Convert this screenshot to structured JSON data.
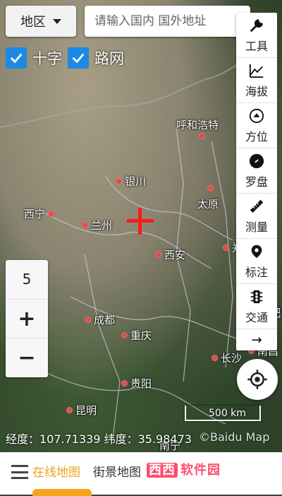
{
  "header": {
    "region_label": "地区",
    "search_placeholder": "请输入国内 国外地址",
    "close_symbol": "✕"
  },
  "layers": {
    "crosshair_label": "十字",
    "roadnet_label": "路网",
    "crosshair_checked": true,
    "roadnet_checked": true
  },
  "toolbar": {
    "items": [
      {
        "label": "工具",
        "icon": "wrench-icon"
      },
      {
        "label": "海拔",
        "icon": "elevation-chart-icon"
      },
      {
        "label": "方位",
        "icon": "direction-icon"
      },
      {
        "label": "罗盘",
        "icon": "compass-icon"
      },
      {
        "label": "测量",
        "icon": "ruler-icon"
      },
      {
        "label": "标注",
        "icon": "map-pin-icon"
      },
      {
        "label": "交通",
        "icon": "traffic-light-icon"
      }
    ],
    "more_symbol": "→"
  },
  "zoom": {
    "level": "5",
    "plus": "+",
    "minus": "−"
  },
  "map": {
    "cities": [
      {
        "name": "呼和浩特",
        "id": "hohhot"
      },
      {
        "name": "银川",
        "id": "yinchuan"
      },
      {
        "name": "太原",
        "id": "taiyuan"
      },
      {
        "name": "西宁",
        "id": "xining"
      },
      {
        "name": "兰州",
        "id": "lanzhou"
      },
      {
        "name": "西安",
        "id": "xian"
      },
      {
        "name": "郑州",
        "id": "zhengzhou"
      },
      {
        "name": "成都",
        "id": "chengdu"
      },
      {
        "name": "重庆",
        "id": "chongqing"
      },
      {
        "name": "长沙",
        "id": "changsha"
      },
      {
        "name": "南昌",
        "id": "nanchang"
      },
      {
        "name": "贵阳",
        "id": "guiyang"
      },
      {
        "name": "昆明",
        "id": "kunming"
      },
      {
        "name": "合肥",
        "id": "hefei"
      },
      {
        "name": "南宁",
        "id": "nanning"
      }
    ],
    "scale_label": "500 km",
    "attribution": "©Baidu Map"
  },
  "status": {
    "coords_text": "经度：107.71339  纬度：35.98473"
  },
  "bottom": {
    "tab_online": "在线地图",
    "tab_street": "街景地图",
    "tab_partial": "地图",
    "watermark_a": "西西",
    "watermark_b": "软件园"
  },
  "colors": {
    "accent": "#f0a11a",
    "checkbox": "#1e88e5",
    "crosshair": "#ff1a1a",
    "city_dot": "#e24c4c"
  }
}
